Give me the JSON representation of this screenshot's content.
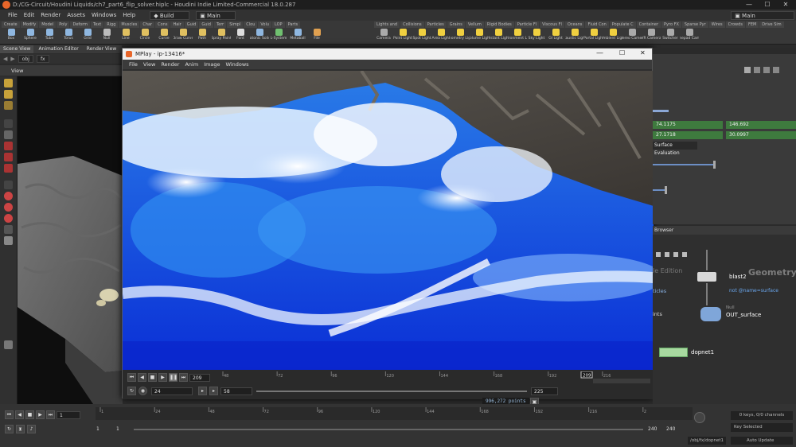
{
  "window": {
    "title": "D:/CG-Circuit/Houdini Liquids/ch7_part6_flip_solver.hiplc - Houdini Indie Limited-Commercial 18.0.287",
    "controls": [
      "—",
      "☐",
      "✕"
    ]
  },
  "menubar": {
    "items": [
      "File",
      "Edit",
      "Render",
      "Assets",
      "Windows",
      "Help"
    ],
    "build_label": "Build",
    "desktop_label": "Main",
    "right_desktop_label": "Main"
  },
  "shelf": {
    "left_tabs": [
      "Create",
      "Modify",
      "Model",
      "Poly",
      "Deform",
      "Text",
      "Rigg",
      "Muscles",
      "Char",
      "Cons",
      "Hair",
      "Guid",
      "Guid",
      "Terr",
      "Simpl",
      "Clou",
      "Volu",
      "LOP",
      "Parts"
    ],
    "left_tools": [
      {
        "label": "Box",
        "color": "#8fb7e0"
      },
      {
        "label": "Sphere",
        "color": "#8fb7e0"
      },
      {
        "label": "Tube",
        "color": "#8fb7e0"
      },
      {
        "label": "Torus",
        "color": "#8fb7e0"
      },
      {
        "label": "Grid",
        "color": "#8fb7e0"
      },
      {
        "label": "Null",
        "color": "#bbbbbb"
      },
      {
        "label": "Line",
        "color": "#e0c060"
      },
      {
        "label": "Circle",
        "color": "#e0c060"
      },
      {
        "label": "Curve",
        "color": "#e0c060"
      },
      {
        "label": "Draw Curve",
        "color": "#e0c060"
      },
      {
        "label": "Path",
        "color": "#e0c060"
      },
      {
        "label": "Spray Paint",
        "color": "#e0c060"
      },
      {
        "label": "Font",
        "color": "#dddddd"
      },
      {
        "label": "Platonic Solids",
        "color": "#8fb7e0"
      },
      {
        "label": "L-System",
        "color": "#70c070"
      },
      {
        "label": "Metaball",
        "color": "#8fb7e0"
      },
      {
        "label": "File",
        "color": "#e0a050"
      }
    ],
    "right_tabs": [
      "Lights and",
      "Collisions",
      "Particles",
      "Grains",
      "Vellum",
      "Rigid Bodies",
      "Particle Fl",
      "Viscous Fl",
      "Oceans",
      "Fluid Con",
      "Populate C",
      "Container",
      "Pyro FX",
      "Sparse Pyr",
      "Wires",
      "Crowds",
      "FEM",
      "Drive Sim"
    ],
    "right_tools": [
      {
        "label": "Camera",
        "color": "#aaaaaa"
      },
      {
        "label": "Point Light",
        "color": "#f0d040"
      },
      {
        "label": "Spot Light",
        "color": "#f0d040"
      },
      {
        "label": "Area Light",
        "color": "#f0d040"
      },
      {
        "label": "Geometry Light",
        "color": "#f0d040"
      },
      {
        "label": "Volume Light",
        "color": "#f0d040"
      },
      {
        "label": "Distant Light",
        "color": "#f0d040"
      },
      {
        "label": "Environment Light",
        "color": "#f0d040"
      },
      {
        "label": "Sky Light",
        "color": "#f0d040"
      },
      {
        "label": "GI Light",
        "color": "#f0d040"
      },
      {
        "label": "Caustic Light",
        "color": "#f0d040"
      },
      {
        "label": "Portal Light",
        "color": "#f0d040"
      },
      {
        "label": "Ambient Light",
        "color": "#f0d040"
      },
      {
        "label": "Stereo Camera",
        "color": "#aaaaaa"
      },
      {
        "label": "VR Camera",
        "color": "#aaaaaa"
      },
      {
        "label": "Switcher",
        "color": "#aaaaaa"
      },
      {
        "label": "Gamepad Camera",
        "color": "#aaaaaa"
      }
    ]
  },
  "left_pane": {
    "tabs": [
      "Scene View",
      "Animation Editor",
      "Render View"
    ],
    "path_obj": "obj",
    "path_fx": "fx",
    "view_label": "View"
  },
  "mplay": {
    "title": "MPlay - ip-13416*",
    "menu": [
      "File",
      "View",
      "Render",
      "Anim",
      "Image",
      "Windows"
    ],
    "frame_current": "209",
    "frame_field": "209",
    "ruler_ticks": [
      "48",
      "72",
      "96",
      "120",
      "144",
      "168",
      "192",
      "216"
    ],
    "step": "24",
    "range_start": "58",
    "range_end": "225",
    "point_count": "996,272 points"
  },
  "params": {
    "values": [
      "74.1175",
      "146.692",
      "27.1718",
      "30.0997"
    ],
    "section_label": "Surface Evaluation"
  },
  "network": {
    "browser_label": "Browser",
    "context_label": "Geometry",
    "partial_edition": "le Edition",
    "partial_articles": "ticles",
    "partial_points": "ints",
    "nodes": [
      {
        "name": "blast2",
        "comment": "not @name=surface"
      },
      {
        "type": "Null",
        "name": "OUT_surface"
      },
      {
        "name": "dopnet1"
      }
    ]
  },
  "timeline": {
    "ticks": [
      "1",
      "24",
      "48",
      "72",
      "96",
      "120",
      "144",
      "168",
      "192",
      "216",
      "2"
    ],
    "current_frame": "1",
    "start": "1",
    "start2": "1",
    "end": "240",
    "end2": "240",
    "keys_info": "0 keys, 0/0 channels",
    "key_mode": "Key Selected",
    "path": "/obj/fx/dopnet1",
    "update_mode": "Auto Update"
  }
}
